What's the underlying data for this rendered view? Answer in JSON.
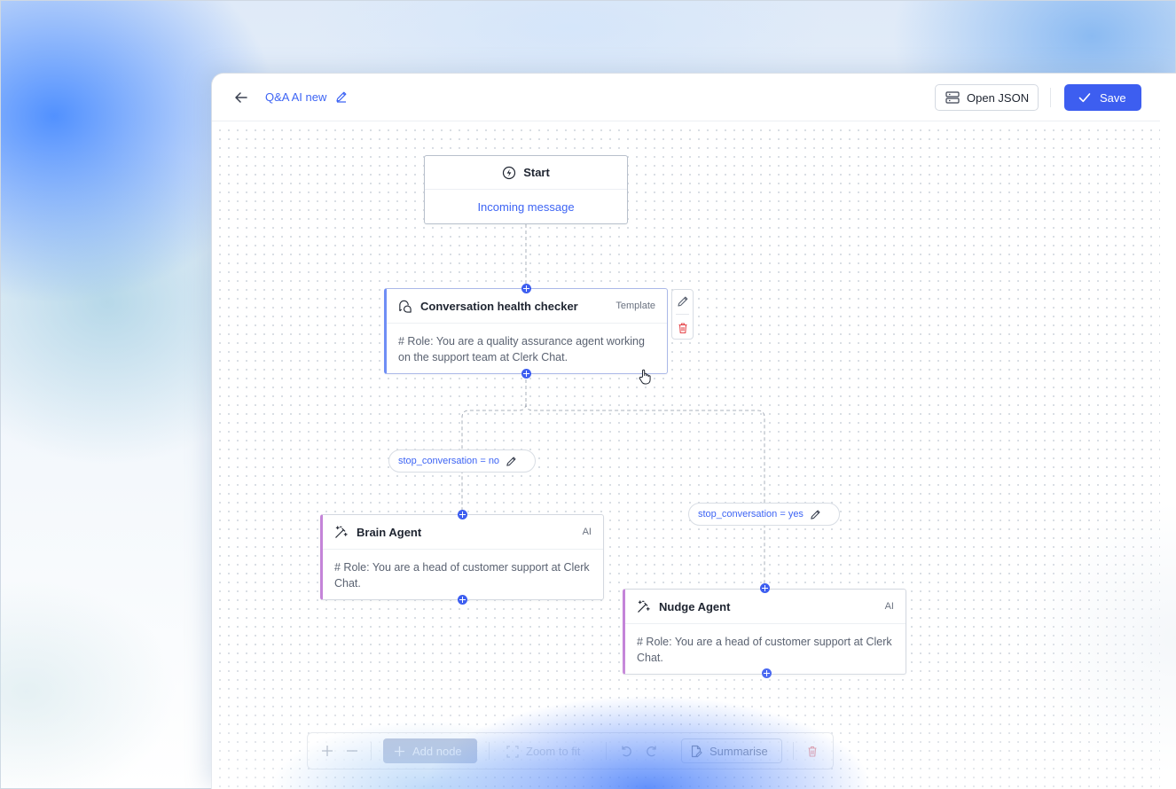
{
  "header": {
    "title": "Q&A AI new",
    "open_json_label": "Open JSON",
    "save_label": "Save"
  },
  "nodes": {
    "start": {
      "title": "Start",
      "trigger": "Incoming message"
    },
    "health_checker": {
      "title": "Conversation health checker",
      "tag": "Template",
      "body": "# Role: You are a quality assurance agent working on the support team at Clerk Chat."
    },
    "brain_agent": {
      "title": "Brain Agent",
      "tag": "AI",
      "body": "# Role: You are a head of customer support at Clerk Chat."
    },
    "nudge_agent": {
      "title": "Nudge Agent",
      "tag": "AI",
      "body": "# Role: You are a head of customer support at Clerk Chat."
    }
  },
  "edges": {
    "no_label": "stop_conversation = no",
    "yes_label": "stop_conversation = yes"
  },
  "toolbar": {
    "add_node_label": "Add node",
    "zoom_to_fit_label": "Zoom to fit",
    "summarise_label": "Summarise"
  },
  "colors": {
    "accent": "#3d5ef0",
    "link_text": "#3d64f4",
    "template_stripe": "#6f8ef5",
    "ai_stripe": "#c484d8",
    "delete_red": "#e5484d"
  }
}
